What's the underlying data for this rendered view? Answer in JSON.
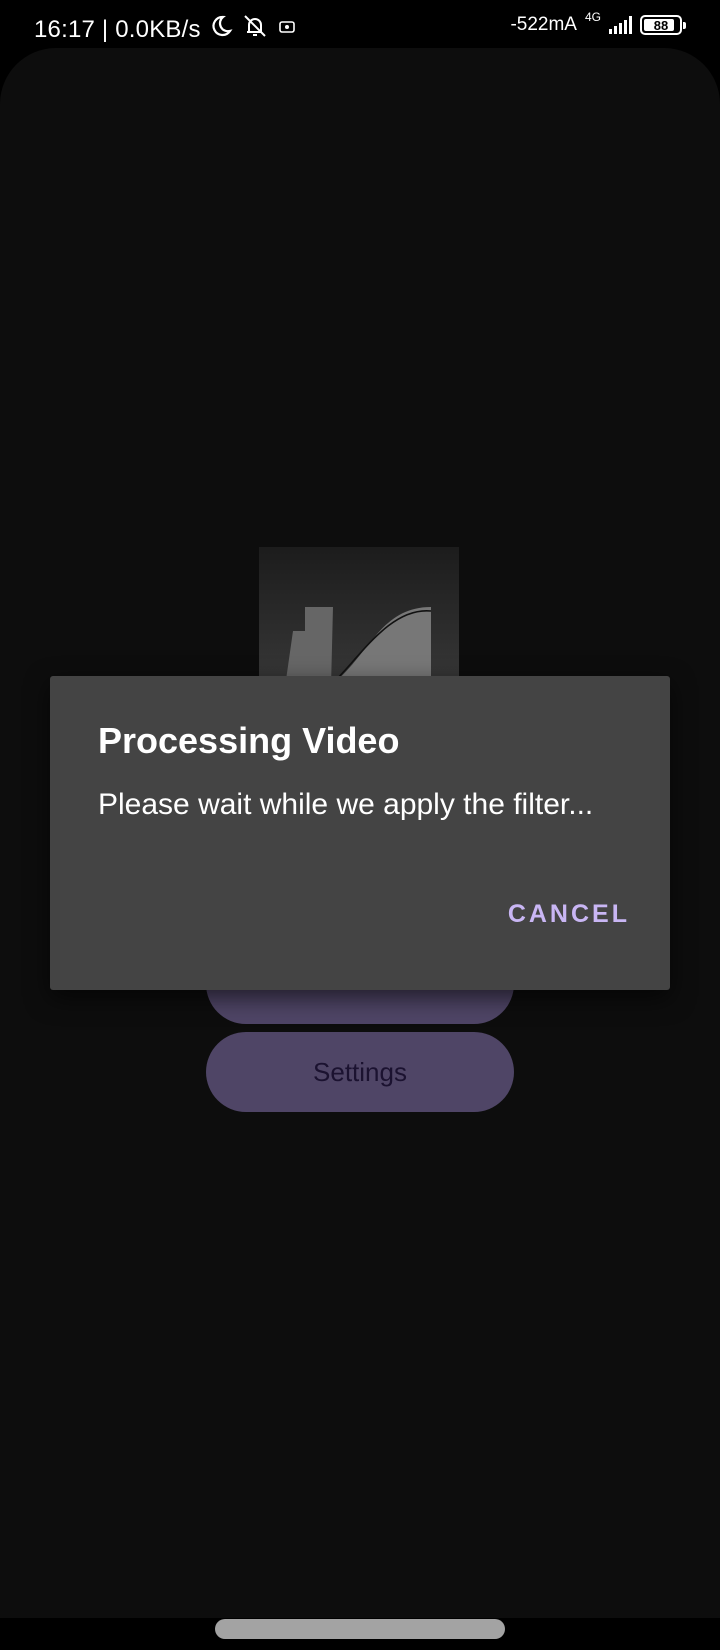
{
  "status_bar": {
    "time_speed": "16:17 | 0.0KB/s",
    "current": "-522mA",
    "network_type": "4G",
    "battery_level": "88",
    "battery_fraction": 0.88
  },
  "main": {
    "buttons": [
      {
        "label": ""
      },
      {
        "label": "Settings"
      }
    ]
  },
  "dialog": {
    "title": "Processing Video",
    "message": "Please wait while we apply the filter...",
    "cancel_label": "CANCEL",
    "accent_color": "#c9b6f4"
  }
}
